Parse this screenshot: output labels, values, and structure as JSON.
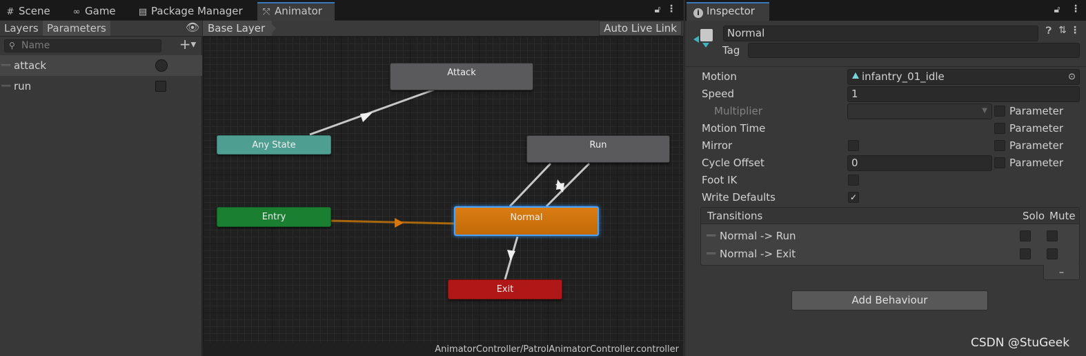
{
  "left_tabs": [
    {
      "icon": "grid-icon",
      "glyph": "#",
      "label": "Scene"
    },
    {
      "icon": "gamepad-icon",
      "glyph": "∞",
      "label": "Game"
    },
    {
      "icon": "package-icon",
      "glyph": "▤",
      "label": "Package Manager"
    },
    {
      "icon": "animator-icon",
      "glyph": "⤲",
      "label": "Animator"
    }
  ],
  "active_tab": "Animator",
  "sub_tabs": {
    "layers": "Layers",
    "parameters": "Parameters"
  },
  "params": {
    "search_placeholder": "Name",
    "items": [
      {
        "name": "attack",
        "type": "trigger"
      },
      {
        "name": "run",
        "type": "bool"
      }
    ]
  },
  "graph": {
    "breadcrumb": "Base Layer",
    "auto_live_link": "Auto Live Link",
    "states": {
      "attack": "Attack",
      "any_state": "Any State",
      "run": "Run",
      "entry": "Entry",
      "normal": "Normal",
      "exit": "Exit"
    },
    "path": "AnimatorController/PatrolAnimatorController.controller"
  },
  "inspector": {
    "tab": "Inspector",
    "name": "Normal",
    "tag_label": "Tag",
    "tag_value": "",
    "rows": {
      "motion_label": "Motion",
      "motion_value": "infantry_01_idle",
      "speed_label": "Speed",
      "speed_value": "1",
      "multiplier_label": "Multiplier",
      "motion_time_label": "Motion Time",
      "mirror_label": "Mirror",
      "cycle_offset_label": "Cycle Offset",
      "cycle_offset_value": "0",
      "foot_ik_label": "Foot IK",
      "write_defaults_label": "Write Defaults",
      "parameter_label": "Parameter"
    },
    "checks": {
      "multiplier_param": false,
      "motion_time_param": false,
      "mirror": false,
      "mirror_param": false,
      "cycle_offset_param": false,
      "foot_ik": false,
      "write_defaults": true
    },
    "transitions": {
      "header": "Transitions",
      "solo": "Solo",
      "mute": "Mute",
      "items": [
        "Normal -> Run",
        "Normal -> Exit"
      ]
    },
    "add_behaviour": "Add Behaviour"
  },
  "watermark": "CSDN @StuGeek",
  "colors": {
    "accent": "#3a79bb",
    "any_state": "#4f9e92",
    "entry": "#1b7f32",
    "normal": "#d6760e",
    "exit": "#b01717",
    "state_default": "#5a5a5c"
  }
}
